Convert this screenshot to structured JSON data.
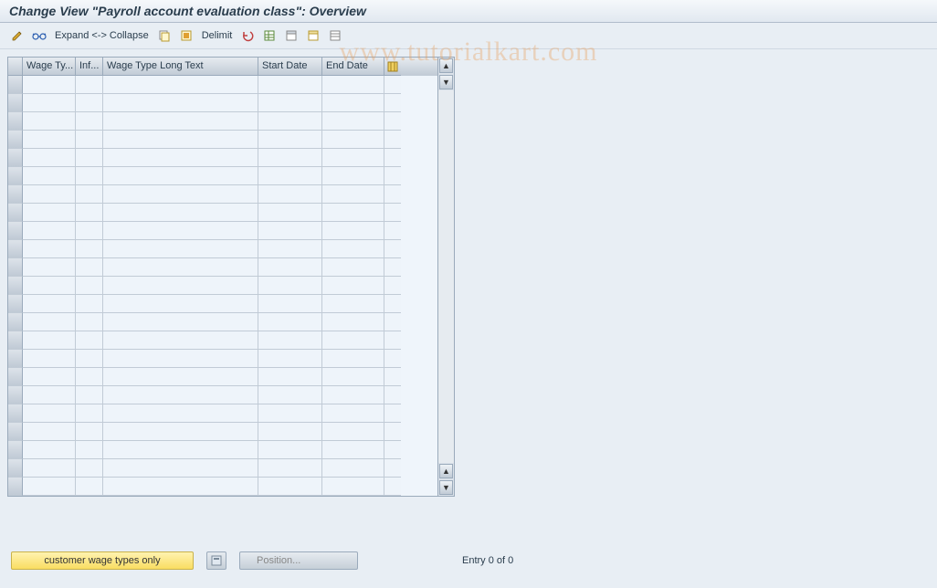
{
  "title": "Change View \"Payroll account evaluation class\": Overview",
  "toolbar": {
    "expand_label": "Expand <-> Collapse",
    "delimit_label": "Delimit"
  },
  "grid": {
    "columns": {
      "wage_type": "Wage Ty...",
      "inf": "Inf...",
      "wage_long": "Wage Type Long Text",
      "start_date": "Start Date",
      "end_date": "End Date"
    },
    "row_count": 23
  },
  "footer": {
    "customer_btn": "customer wage types only",
    "position_btn": "Position...",
    "entry_text": "Entry 0 of 0"
  },
  "watermark": "www.tutorialkart.com"
}
